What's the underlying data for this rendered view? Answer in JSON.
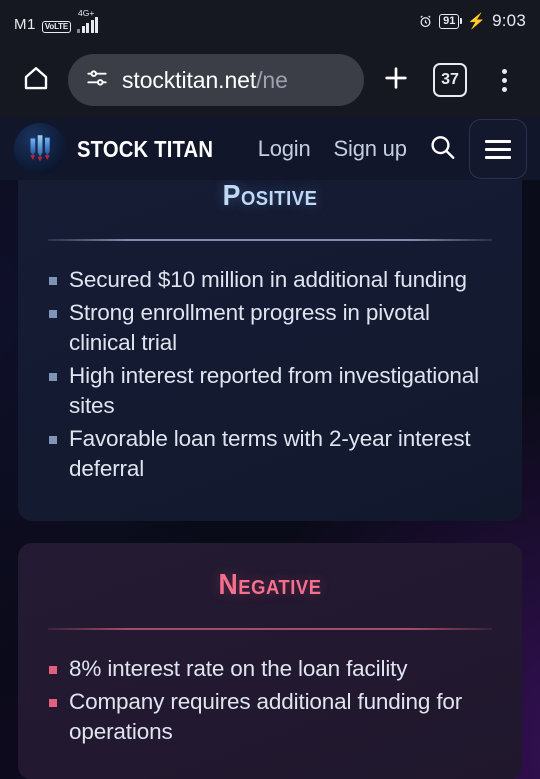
{
  "statusbar": {
    "carrier": "M1",
    "volte": "VoLTE",
    "network": "4G+",
    "battery": "91",
    "time": "9:03"
  },
  "browser": {
    "url_host": "stocktitan.net",
    "url_path": "/ne",
    "tab_count": "37"
  },
  "site": {
    "brand": "STOCK TITAN",
    "login": "Login",
    "signup": "Sign up"
  },
  "cards": [
    {
      "title": "Positive",
      "tone": "positive",
      "items": [
        "Secured $10 million in additional funding",
        "Strong enrollment progress in pivotal clinical trial",
        "High interest reported from investigational sites",
        "Favorable loan terms with 2-year interest deferral"
      ]
    },
    {
      "title": "Negative",
      "tone": "negative",
      "items": [
        "8% interest rate on the loan facility",
        "Company requires additional funding for operations"
      ]
    }
  ],
  "colors": {
    "positive_accent": "#bfdaf7",
    "negative_accent": "#f4708d",
    "positive_card_bg": "#161c35",
    "negative_card_bg": "#241a33",
    "header_bg": "#12162a",
    "chrome_bg": "#151821",
    "urlbar_bg": "#3b3e47"
  }
}
